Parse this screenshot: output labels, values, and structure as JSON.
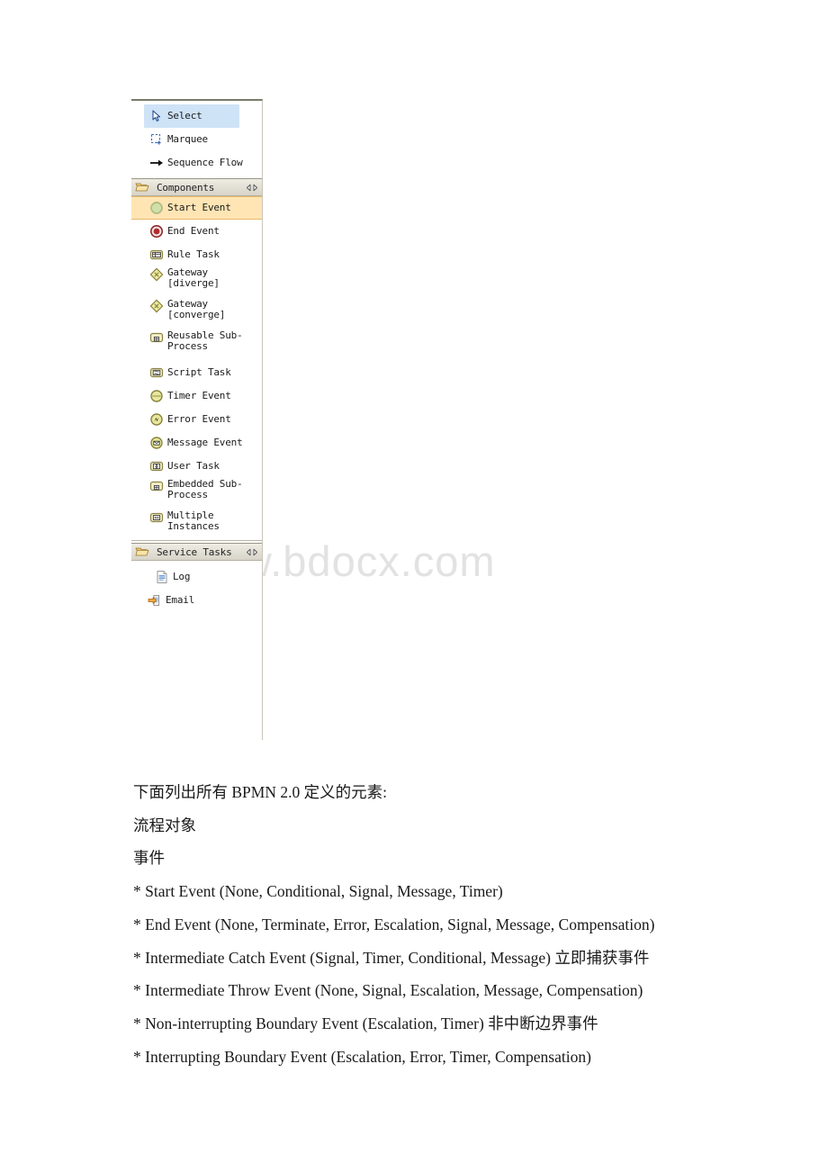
{
  "watermark": {
    "text": "www.bdocx.com",
    "color": "#e2e2e2"
  },
  "palette": {
    "tools": [
      {
        "label": "Select",
        "icon": "cursor-arrow-icon",
        "state": "selected"
      },
      {
        "label": "Marquee",
        "icon": "marquee-dashed-box-icon",
        "state": "normal"
      },
      {
        "label": "Sequence Flow",
        "icon": "arrow-right-icon",
        "state": "normal"
      }
    ],
    "sections": [
      {
        "title": "Components",
        "icon": "open-folder-icon",
        "collapse_icon": "collapse-arrows-icon",
        "items": [
          {
            "label": "Start Event",
            "label2": "",
            "icon": "start-event-circle-icon",
            "state": "highlighted"
          },
          {
            "label": "End Event",
            "label2": "",
            "icon": "end-event-circle-icon",
            "state": "normal"
          },
          {
            "label": "Rule Task",
            "label2": "",
            "icon": "rule-task-icon",
            "state": "normal"
          },
          {
            "label": "Gateway",
            "label2": "[diverge]",
            "icon": "gateway-diamond-icon",
            "state": "normal"
          },
          {
            "label": "Gateway",
            "label2": "[converge]",
            "icon": "gateway-diamond-icon",
            "state": "normal"
          },
          {
            "label": "Reusable Sub-",
            "label2": "Process",
            "icon": "reusable-subprocess-icon",
            "state": "normal"
          },
          {
            "label": "Script Task",
            "label2": "",
            "icon": "script-task-icon",
            "state": "normal"
          },
          {
            "label": "Timer Event",
            "label2": "",
            "icon": "timer-event-icon",
            "state": "normal"
          },
          {
            "label": "Error Event",
            "label2": "",
            "icon": "error-event-icon",
            "state": "normal"
          },
          {
            "label": "Message Event",
            "label2": "",
            "icon": "message-event-icon",
            "state": "normal"
          },
          {
            "label": "User Task",
            "label2": "",
            "icon": "user-task-icon",
            "state": "normal"
          },
          {
            "label": "Embedded Sub-",
            "label2": "Process",
            "icon": "embedded-subprocess-icon",
            "state": "normal"
          },
          {
            "label": "Multiple",
            "label2": "Instances",
            "icon": "multiple-instances-icon",
            "state": "normal"
          }
        ]
      },
      {
        "title": "Service Tasks",
        "icon": "open-folder-icon",
        "collapse_icon": "collapse-arrows-icon",
        "items": [
          {
            "label": "Log",
            "label2": "",
            "icon": "log-document-icon",
            "state": "normal"
          },
          {
            "label": "Email",
            "label2": "",
            "icon": "email-arrow-icon",
            "state": "normal"
          }
        ]
      }
    ]
  },
  "document": {
    "lines": [
      "下面列出所有 BPMN 2.0 定义的元素:",
      "流程对象",
      "事件",
      "* Start Event (None, Conditional, Signal, Message, Timer)",
      "* End Event (None, Terminate, Error, Escalation, Signal, Message, Compensation)",
      "* Intermediate Catch Event (Signal, Timer, Conditional, Message) 立即捕获事件",
      "* Intermediate Throw Event (None, Signal, Escalation, Message, Compensation)",
      "* Non-interrupting Boundary Event (Escalation, Timer) 非中断边界事件",
      "* Interrupting Boundary Event (Escalation, Error, Timer, Compensation)"
    ]
  }
}
